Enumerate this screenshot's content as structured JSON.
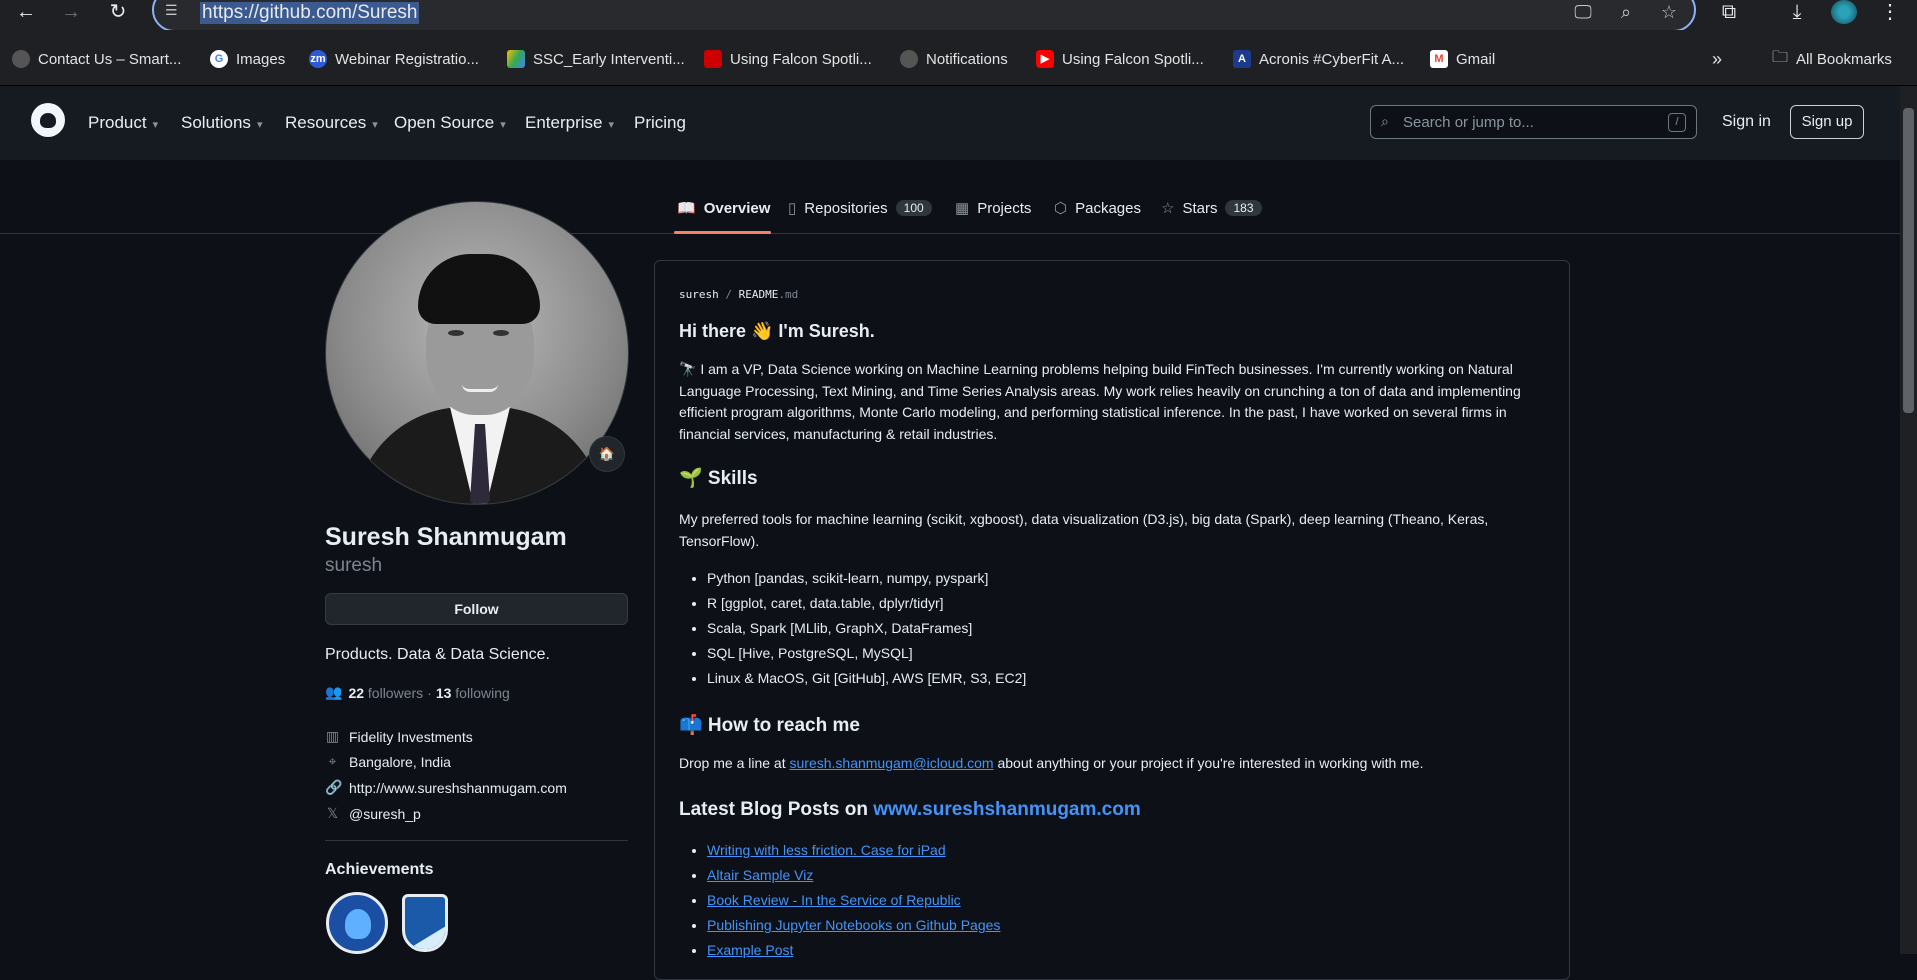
{
  "browser": {
    "url": "https://github.com/Suresh",
    "bookmarks": [
      {
        "label": "Contact Us – Smart..."
      },
      {
        "label": "Images"
      },
      {
        "label": "Webinar Registratio..."
      },
      {
        "label": "SSC_Early Interventi..."
      },
      {
        "label": "Using Falcon Spotli..."
      },
      {
        "label": "Notifications"
      },
      {
        "label": "Using Falcon Spotli..."
      },
      {
        "label": "Acronis #CyberFit A..."
      },
      {
        "label": "Gmail"
      }
    ],
    "all_bookmarks": "All Bookmarks",
    "more": "»"
  },
  "header": {
    "nav": [
      "Product",
      "Solutions",
      "Resources",
      "Open Source",
      "Enterprise",
      "Pricing"
    ],
    "search_placeholder": "Search or jump to...",
    "search_shortcut": "/",
    "sign_in": "Sign in",
    "sign_up": "Sign up"
  },
  "tabs": [
    {
      "label": "Overview"
    },
    {
      "label": "Repositories",
      "count": "100"
    },
    {
      "label": "Projects"
    },
    {
      "label": "Packages"
    },
    {
      "label": "Stars",
      "count": "183"
    }
  ],
  "profile": {
    "status_emoji": "🏠",
    "name": "Suresh Shanmugam",
    "login": "suresh",
    "follow": "Follow",
    "bio": "Products. Data & Data Science.",
    "followers_count": "22",
    "followers_label": "followers",
    "dot": "·",
    "following_count": "13",
    "following_label": "following",
    "company": "Fidelity Investments",
    "location": "Bangalore, India",
    "website": "http://www.sureshshanmugam.com",
    "twitter": "@suresh_p",
    "achievements_title": "Achievements"
  },
  "readme": {
    "path_user": "suresh",
    "path_sep": "/",
    "path_file": "README",
    "path_ext": ".md",
    "greeting": "Hi there 👋 I'm Suresh.",
    "intro": "🔭 I am a VP, Data Science working on Machine Learning problems helping build FinTech businesses. I'm currently working on Natural Language Processing, Text Mining, and Time Series Analysis areas. My work relies heavily on crunching a ton of data and implementing efficient program algorithms, Monte Carlo modeling, and performing statistical inference. In the past, I have worked on several firms in financial services, manufacturing & retail industries.",
    "skills_heading": "🌱 Skills",
    "skills_text": "My preferred tools for machine learning (scikit, xgboost), data visualization (D3.js), big data (Spark), deep learning (Theano, Keras, TensorFlow).",
    "skills": [
      "Python [pandas, scikit-learn, numpy, pyspark]",
      "R [ggplot, caret, data.table, dplyr/tidyr]",
      "Scala, Spark [MLlib, GraphX, DataFrames]",
      "SQL [Hive, PostgreSQL, MySQL]",
      "Linux & MacOS, Git [GitHub], AWS [EMR, S3, EC2]"
    ],
    "reach_heading": "📫 How to reach me",
    "reach_prefix": "Drop me a line at",
    "reach_email": "suresh.shanmugam@icloud.com",
    "reach_suffix": "about anything or your project if you're interested in working with me.",
    "blog_heading_prefix": "Latest Blog Posts on",
    "blog_heading_link": "www.sureshshanmugam.com",
    "posts": [
      "Writing with less friction. Case for iPad",
      "Altair Sample Viz",
      "Book Review - In the Service of Republic",
      "Publishing Jupyter Notebooks on Github Pages",
      "Example Post"
    ]
  }
}
